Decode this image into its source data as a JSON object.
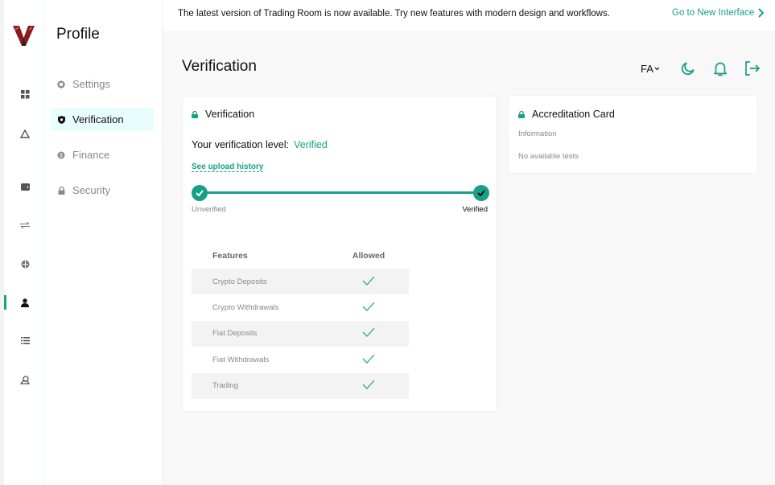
{
  "app": {
    "logo": "V-logo",
    "accent": "#17a085"
  },
  "rail": {
    "items": [
      {
        "icon": "dashboard-icon",
        "active": false
      },
      {
        "icon": "recycle-icon",
        "active": false
      },
      {
        "icon": "wallet-icon",
        "active": false
      },
      {
        "icon": "exchange-icon",
        "active": false
      },
      {
        "icon": "globe-icon",
        "active": false
      },
      {
        "icon": "user-icon",
        "active": true
      },
      {
        "icon": "list-icon",
        "active": false
      },
      {
        "icon": "referral-icon",
        "active": false
      }
    ]
  },
  "subnav": {
    "title": "Profile",
    "items": [
      {
        "label": "Settings",
        "icon": "gear-icon",
        "active": false
      },
      {
        "label": "Verification",
        "icon": "shield-icon",
        "active": true
      },
      {
        "label": "Finance",
        "icon": "coin-icon",
        "active": false
      },
      {
        "label": "Security",
        "icon": "lock-icon",
        "active": false
      }
    ]
  },
  "banner": {
    "message": "The latest version of Trading Room is now available. Try new features with modern design and workflows.",
    "link_label": "Go to New Interface"
  },
  "header": {
    "title": "Verification",
    "language": "FA"
  },
  "verification_card": {
    "title": "Verification",
    "level_label": "Your verification level:",
    "level_value": "Verified",
    "history_link": "See upload history",
    "steps": [
      {
        "label": "Unverified",
        "done": true
      },
      {
        "label": "Verified",
        "done": true,
        "current": true
      }
    ],
    "table": {
      "headers": [
        "Features",
        "Allowed"
      ],
      "rows": [
        {
          "feature": "Crypto Deposits",
          "allowed": true
        },
        {
          "feature": "Crypto Withdrawals",
          "allowed": true
        },
        {
          "feature": "Fiat Deposits",
          "allowed": true
        },
        {
          "feature": "Fiat Withdrawals",
          "allowed": true
        },
        {
          "feature": "Trading",
          "allowed": true
        }
      ]
    }
  },
  "accreditation_card": {
    "title": "Accreditation Card",
    "info_label": "Information",
    "empty_text": "No available tests"
  }
}
